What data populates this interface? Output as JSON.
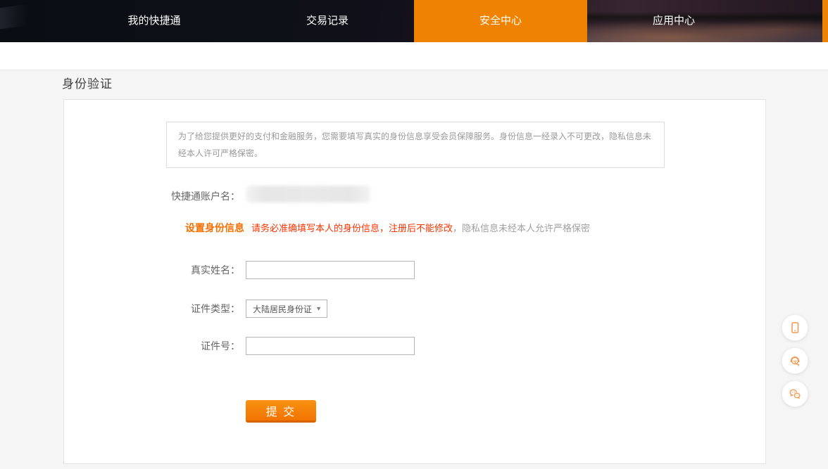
{
  "nav": {
    "tabs": [
      {
        "label": "我的快捷通",
        "active": false
      },
      {
        "label": "交易记录",
        "active": false
      },
      {
        "label": "安全中心",
        "active": true
      },
      {
        "label": "应用中心",
        "active": false
      }
    ]
  },
  "page": {
    "title": "身份验证"
  },
  "notice": {
    "text": "为了给您提供更好的支付和金融服务，您需要填写真实的身份信息享受会员保障服务。身份信息一经录入不可更改，隐私信息未经本人许可严格保密。"
  },
  "account": {
    "label": "快捷通账户名：",
    "value_redacted": true
  },
  "section": {
    "title": "设置身份信息",
    "warning_red": "请务必准确填写本人的身份信息，注册后不能修改",
    "warning_gray": "，隐私信息未经本人允许严格保密"
  },
  "form": {
    "real_name_label": "真实姓名：",
    "real_name_value": "",
    "real_name_placeholder": "",
    "id_type_label": "证件类型：",
    "id_type_value": "大陆居民身份证",
    "id_type_arrow": "▼",
    "id_number_label": "证件号：",
    "id_number_value": "",
    "id_number_placeholder": "",
    "submit_label": "提 交"
  },
  "floating_tools": [
    {
      "icon": "mobile-icon"
    },
    {
      "icon": "customer-service-chat-icon"
    },
    {
      "icon": "wechat-icon"
    }
  ],
  "colors": {
    "accent_orange": "#ef8200",
    "button_orange_top": "#fa9212",
    "button_orange_bottom": "#f17300",
    "section_title_orange": "#f57000",
    "warning_red": "#ff3300",
    "icon_orange": "#f09a50"
  }
}
